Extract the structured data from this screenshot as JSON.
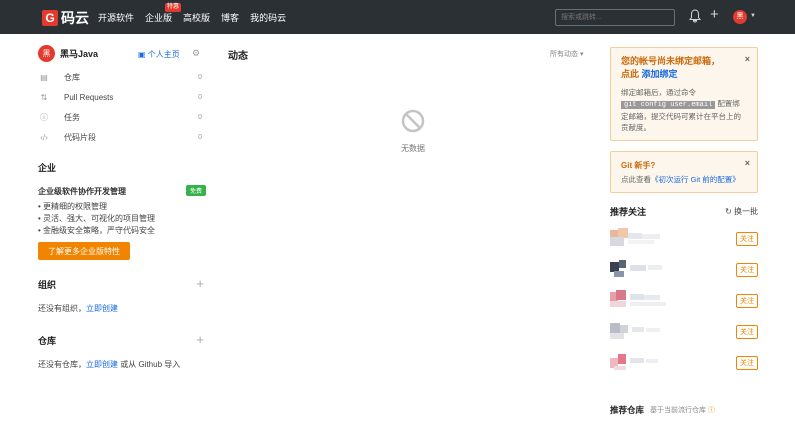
{
  "topbar": {
    "logo_text": "码云",
    "logo_mark": "G",
    "nav": [
      {
        "label": "开源软件"
      },
      {
        "label": "企业版",
        "badge": "特惠"
      },
      {
        "label": "高校版"
      },
      {
        "label": "博客"
      },
      {
        "label": "我的码云"
      }
    ],
    "search_placeholder": "搜索或跳转...",
    "avatar_initial": "黑"
  },
  "sidebar": {
    "username": "黑马Java",
    "avatar_initial": "黑",
    "homepage_label": "个人主页",
    "menu": [
      {
        "label": "仓库",
        "count": "0",
        "icon": "book-icon"
      },
      {
        "label": "Pull Requests",
        "count": "0",
        "icon": "pull-request-icon"
      },
      {
        "label": "任务",
        "count": "0",
        "icon": "issue-icon"
      },
      {
        "label": "代码片段",
        "count": "0",
        "icon": "code-icon"
      }
    ],
    "enterprise": {
      "title": "企业",
      "subtitle": "企业级软件协作开发管理",
      "free_badge": "免费",
      "bullets": [
        "• 更精细的权限管理",
        "• 灵活、强大、可视化的项目管理",
        "• 金融级安全策略，严守代码安全"
      ],
      "button": "了解更多企业版特性"
    },
    "org": {
      "title": "组织",
      "empty_prefix": "还没有组织，",
      "create_link": "立即创建"
    },
    "repo": {
      "title": "仓库",
      "empty_prefix": "还没有仓库，",
      "create_link": "立即创建",
      "or_text": " 或从 Github 导入"
    }
  },
  "main": {
    "title": "动态",
    "filter": "所有动态 ▾",
    "empty": "无数据"
  },
  "right": {
    "email_notice": {
      "title_line1": "您的帐号尚未绑定邮箱，",
      "title_line2_prefix": "点此 ",
      "title_link": "添加绑定",
      "body_prefix": "绑定邮箱后，通过命令",
      "code": "git config user.email",
      "body_suffix": "配置绑定邮箱，提交代码可累计在平台上的贡献度。"
    },
    "git_notice": {
      "title": "Git 新手?",
      "body_prefix": "点此查看",
      "link": "《初次运行 Git 前的配置》"
    },
    "recommend": {
      "title": "推荐关注",
      "refresh": "换一批",
      "follow_label": "关注",
      "count": 5
    },
    "recommend_repos": {
      "title": "推荐仓库",
      "subtitle": "基于当前流行仓库"
    }
  },
  "colors": {
    "topbar": "#2b3035",
    "brand_red": "#e33a2d",
    "accent_orange": "#f18400",
    "link_blue": "#1a6ae0",
    "badge_green": "#35b24a"
  }
}
